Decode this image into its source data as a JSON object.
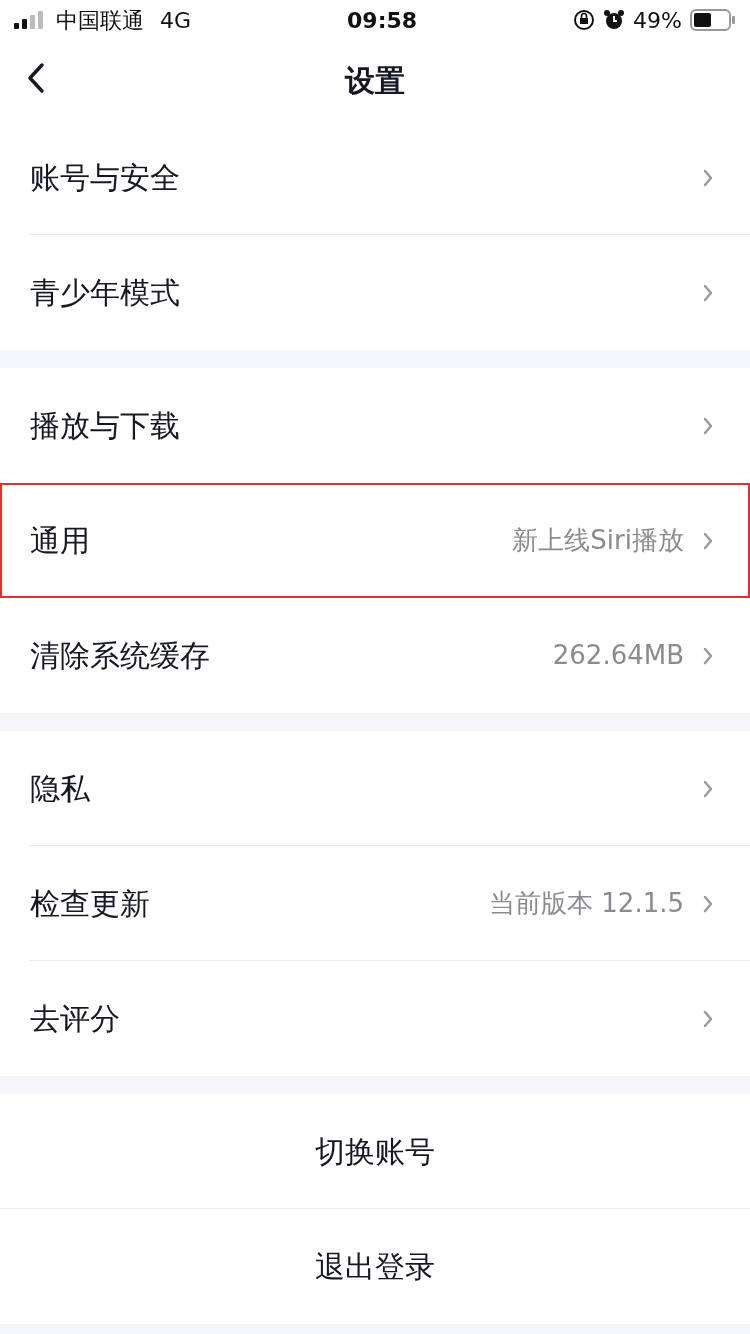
{
  "status_bar": {
    "carrier": "中国联通",
    "network": "4G",
    "time": "09:58",
    "battery": "49%"
  },
  "nav": {
    "title": "设置"
  },
  "groups": [
    {
      "kind": "list",
      "rows": [
        {
          "label": "账号与安全",
          "highlighted": false
        },
        {
          "label": "青少年模式",
          "highlighted": false
        }
      ]
    },
    {
      "kind": "list",
      "rows": [
        {
          "label": "播放与下载",
          "highlighted": false
        },
        {
          "label": "通用",
          "value": "新上线Siri播放",
          "highlighted": true
        },
        {
          "label": "清除系统缓存",
          "value": "262.64MB",
          "highlighted": false
        }
      ]
    },
    {
      "kind": "list",
      "rows": [
        {
          "label": "隐私",
          "highlighted": false
        },
        {
          "label": "检查更新",
          "value": "当前版本 12.1.5",
          "highlighted": false
        },
        {
          "label": "去评分",
          "highlighted": false
        }
      ]
    },
    {
      "kind": "actions",
      "rows": [
        {
          "label": "切换账号"
        },
        {
          "label": "退出登录"
        }
      ]
    }
  ]
}
